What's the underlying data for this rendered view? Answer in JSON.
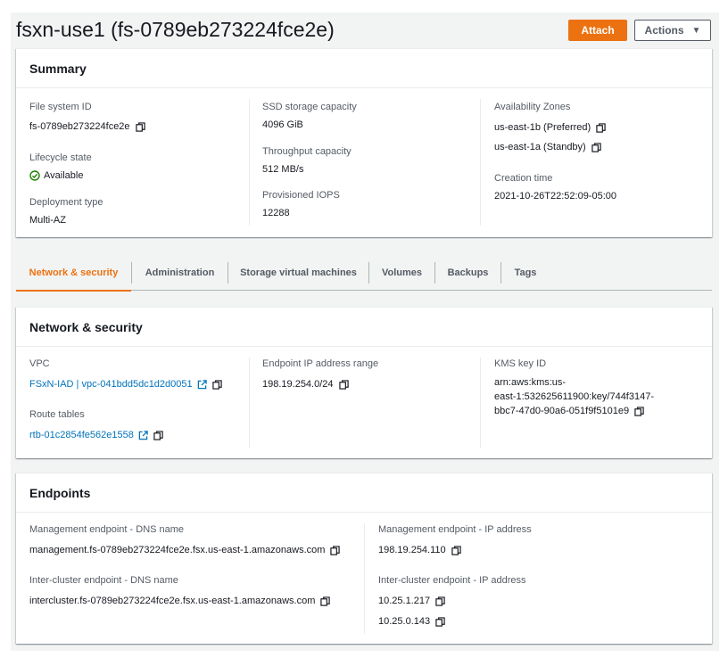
{
  "header": {
    "title": "fsxn-use1 (fs-0789eb273224fce2e)",
    "attach_label": "Attach",
    "actions_label": "Actions"
  },
  "summary": {
    "title": "Summary",
    "file_system_id_label": "File system ID",
    "file_system_id": "fs-0789eb273224fce2e",
    "lifecycle_label": "Lifecycle state",
    "lifecycle_value": "Available",
    "deployment_label": "Deployment type",
    "deployment_value": "Multi-AZ",
    "ssd_label": "SSD storage capacity",
    "ssd_value": "4096 GiB",
    "throughput_label": "Throughput capacity",
    "throughput_value": "512 MB/s",
    "iops_label": "Provisioned IOPS",
    "iops_value": "12288",
    "az_label": "Availability Zones",
    "az_preferred": "us-east-1b (Preferred)",
    "az_standby": "us-east-1a (Standby)",
    "creation_label": "Creation time",
    "creation_value": "2021-10-26T22:52:09-05:00"
  },
  "tabs": [
    "Network & security",
    "Administration",
    "Storage virtual machines",
    "Volumes",
    "Backups",
    "Tags"
  ],
  "network": {
    "title": "Network & security",
    "vpc_label": "VPC",
    "vpc_value": "FSxN-IAD | vpc-041bdd5dc1d2d0051",
    "route_label": "Route tables",
    "route_value": "rtb-01c2854fe562e1558",
    "endpoint_range_label": "Endpoint IP address range",
    "endpoint_range_value": "198.19.254.0/24",
    "kms_label": "KMS key ID",
    "kms_line1": "arn:aws:kms:us-",
    "kms_line2": "east-1:532625611900:key/744f3147-",
    "kms_line3": "bbc7-47d0-90a6-051f9f5101e9"
  },
  "endpoints": {
    "title": "Endpoints",
    "mgmt_dns_label": "Management endpoint - DNS name",
    "mgmt_dns_value": "management.fs-0789eb273224fce2e.fsx.us-east-1.amazonaws.com",
    "inter_dns_label": "Inter-cluster endpoint - DNS name",
    "inter_dns_value": "intercluster.fs-0789eb273224fce2e.fsx.us-east-1.amazonaws.com",
    "mgmt_ip_label": "Management endpoint - IP address",
    "mgmt_ip_value": "198.19.254.110",
    "inter_ip_label": "Inter-cluster endpoint - IP address",
    "inter_ip_1": "10.25.1.217",
    "inter_ip_2": "10.25.0.143"
  },
  "colors": {
    "accent": "#ec7211",
    "link": "#0073bb",
    "success": "#1d8102",
    "text": "#16191f",
    "label": "#545b64"
  },
  "icons": [
    "copy-icon",
    "external-link-icon",
    "check-circle-icon",
    "caret-down-icon"
  ]
}
